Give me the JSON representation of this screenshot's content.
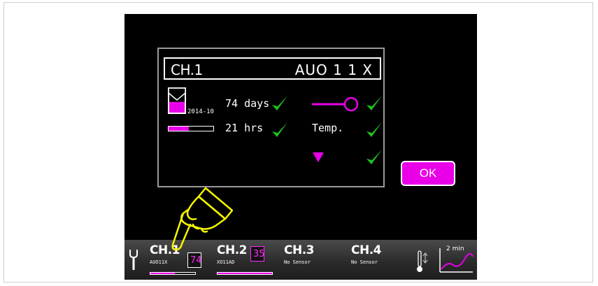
{
  "dialog": {
    "channel": "CH.1",
    "model": "AUO 1 1 X",
    "date": "2014-10",
    "days_text": "74 days",
    "hours_text": "21 hrs",
    "temp_label": "Temp.",
    "hourglass_level": 0.45,
    "hours_progress": 0.45
  },
  "ok_button": {
    "label": "OK"
  },
  "channels": [
    {
      "name": "CH.1",
      "sub": "AUO11X",
      "tile_value": "74",
      "progress": 0.55
    },
    {
      "name": "CH.2",
      "sub": "XO11AD",
      "tile_value": "35",
      "progress": 1.0
    },
    {
      "name": "CH.3",
      "sub": "No Sensor"
    },
    {
      "name": "CH.4",
      "sub": "No Sensor"
    }
  ],
  "trend": {
    "label": "2 min"
  },
  "icons": {
    "settings": "wrench-icon",
    "sensor": "thermometer-icon",
    "trend": "trend-graph-icon",
    "pointer": "hand-pointer-icon",
    "check": "checkmark-icon",
    "flow": "flow-restrictor-icon",
    "alarm": "down-triangle-icon"
  },
  "colors": {
    "accent": "#e900e9",
    "check": "#1fbf1f",
    "background": "#000000"
  }
}
